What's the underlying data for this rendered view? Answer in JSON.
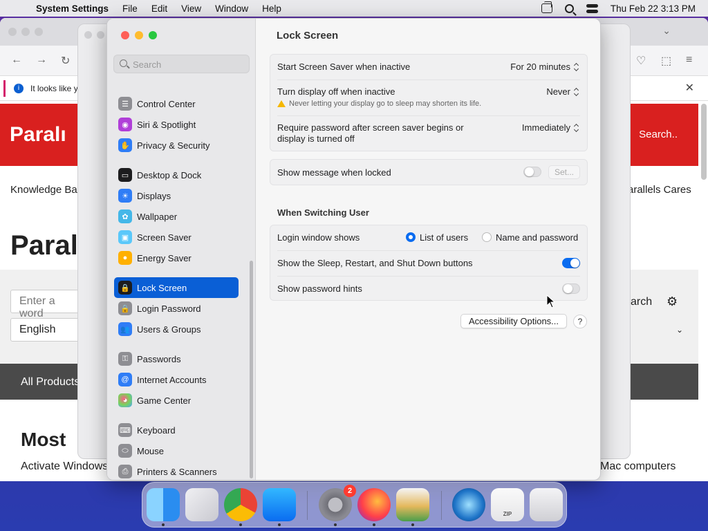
{
  "menubar": {
    "app_name": "System Settings",
    "items": [
      "File",
      "Edit",
      "View",
      "Window",
      "Help"
    ],
    "clock": "Thu Feb 22  3:13 PM"
  },
  "browser": {
    "notice_text": "It looks like y",
    "logo_text": "Paralı",
    "header_search": "Search..",
    "nav_left": "Knowledge Ba",
    "nav_right": "arallels Cares",
    "big_title": "Paral",
    "input_placeholder": "Enter a word",
    "language": "English",
    "search_btn": "arch",
    "all_products": "All Products",
    "most_title": "Most",
    "activate_text": "Activate Windows",
    "mac_computers": "Mac computers"
  },
  "sidebar": {
    "search_placeholder": "Search",
    "items": [
      {
        "label": "Control Center",
        "color": "#8e8e93",
        "icon": "control-center-icon",
        "glyph": "☰"
      },
      {
        "label": "Siri & Spotlight",
        "color": "#b03fd8",
        "icon": "siri-icon",
        "glyph": "◉"
      },
      {
        "label": "Privacy & Security",
        "color": "#2f7df6",
        "icon": "hand-icon",
        "glyph": "✋"
      },
      {
        "label": "Desktop & Dock",
        "color": "#1c1c1e",
        "icon": "dock-icon",
        "glyph": "▭"
      },
      {
        "label": "Displays",
        "color": "#2f7df6",
        "icon": "sun-icon",
        "glyph": "☀"
      },
      {
        "label": "Wallpaper",
        "color": "#44b7e8",
        "icon": "flower-icon",
        "glyph": "✿"
      },
      {
        "label": "Screen Saver",
        "color": "#5ac8fa",
        "icon": "screen-saver-icon",
        "glyph": "▣"
      },
      {
        "label": "Energy Saver",
        "color": "#ffb000",
        "icon": "bulb-icon",
        "glyph": "●"
      },
      {
        "label": "Lock Screen",
        "color": "#1c1c1e",
        "icon": "lock-icon",
        "glyph": "🔒"
      },
      {
        "label": "Login Password",
        "color": "#8e8e93",
        "icon": "lock-icon",
        "glyph": "🔒"
      },
      {
        "label": "Users & Groups",
        "color": "#2f7df6",
        "icon": "users-icon",
        "glyph": "👥"
      },
      {
        "label": "Passwords",
        "color": "#8e8e93",
        "icon": "key-icon",
        "glyph": "⚿"
      },
      {
        "label": "Internet Accounts",
        "color": "#2f7df6",
        "icon": "at-icon",
        "glyph": "@"
      },
      {
        "label": "Game Center",
        "color": "#ffffff",
        "icon": "game-center-icon",
        "glyph": "◕"
      },
      {
        "label": "Keyboard",
        "color": "#8e8e93",
        "icon": "keyboard-icon",
        "glyph": "⌨"
      },
      {
        "label": "Mouse",
        "color": "#8e8e93",
        "icon": "mouse-icon",
        "glyph": "⬭"
      },
      {
        "label": "Printers & Scanners",
        "color": "#8e8e93",
        "icon": "printer-icon",
        "glyph": "⎙"
      }
    ]
  },
  "content": {
    "title": "Lock Screen",
    "screensaver_label": "Start Screen Saver when inactive",
    "screensaver_value": "For 20 minutes",
    "display_off_label": "Turn display off when inactive",
    "display_off_value": "Never",
    "display_off_warning": "Never letting your display go to sleep may shorten its life.",
    "require_pw_label_1": "Require password after screen saver begins or",
    "require_pw_label_2": "display is turned off",
    "require_pw_value": "Immediately",
    "show_message_label": "Show message when locked",
    "show_message_on": false,
    "set_button": "Set...",
    "switching_title": "When Switching User",
    "login_window_label": "Login window shows",
    "radio_list": "List of users",
    "radio_name": "Name and password",
    "radio_selected": "List of users",
    "sleep_buttons_label": "Show the Sleep, Restart, and Shut Down buttons",
    "sleep_buttons_on": true,
    "pw_hints_label": "Show password hints",
    "pw_hints_on": false,
    "accessibility_button": "Accessibility Options...",
    "help_button": "?"
  },
  "dock": {
    "items": [
      {
        "name": "Finder",
        "icon": "finder-icon"
      },
      {
        "name": "Launchpad",
        "icon": "launchpad-icon"
      },
      {
        "name": "Google Chrome",
        "icon": "chrome-icon"
      },
      {
        "name": "App Store",
        "icon": "app-store-icon"
      },
      {
        "name": "System Settings",
        "icon": "settings-icon",
        "badge": "2"
      },
      {
        "name": "Firefox",
        "icon": "firefox-icon"
      },
      {
        "name": "macOS Installer",
        "icon": "installer-icon"
      },
      {
        "name": "Network Radar",
        "icon": "radar-icon"
      },
      {
        "name": "Archive",
        "icon": "zip-icon",
        "label": "ZIP"
      },
      {
        "name": "Trash",
        "icon": "trash-icon"
      }
    ]
  },
  "colors": {
    "accent": "#0a6cf0",
    "selection": "#0a5fd6",
    "brand_red": "#d9201f"
  }
}
